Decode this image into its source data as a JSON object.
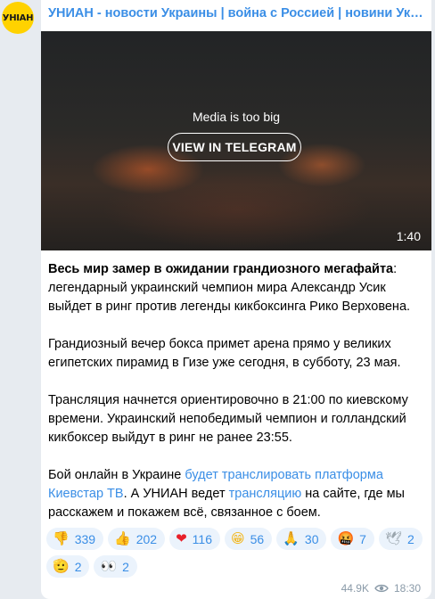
{
  "channel": {
    "avatar_text": "УНІАН",
    "name": "УНИАН - новости Украины | война с Россией | новини Україні…"
  },
  "media": {
    "message": "Media is too big",
    "button_label": "VIEW IN TELEGRAM",
    "duration": "1:40"
  },
  "post": {
    "p1_bold": "Весь мир замер в ожидании грандиозного мегафайта",
    "p1_rest": ": легендарный украинский чемпион мира Александр Усик выйдет в ринг против легенды кикбоксинга Рико Верховена.",
    "p2": "Грандиозный вечер бокса примет арена прямо у великих египетских пирамид в Гизе уже сегодня, в субботу, 23 мая.",
    "p3": "Трансляция начнется ориентировочно в 21:00 по киевскому времени. Украинский непобедимый чемпион и голландский кикбоксер выйдут в ринг не ранее 23:55.",
    "p4_a": "Бой онлайн в Украине ",
    "p4_link1": "будет транслировать платформа Киевстар ТВ",
    "p4_b": ". А УНИАН ведет ",
    "p4_link2": "трансляцию",
    "p4_c": " на сайте, где мы расскажем и покажем всё, связанное с боем."
  },
  "reactions": [
    {
      "emoji": "👎",
      "icon": "thumbs-down-icon",
      "count": "339",
      "color": "#f4a020"
    },
    {
      "emoji": "👍",
      "icon": "thumbs-up-icon",
      "count": "202",
      "color": "#f4b81a"
    },
    {
      "emoji": "❤",
      "icon": "heart-icon",
      "count": "116",
      "color": "#e8202a"
    },
    {
      "emoji": "😁",
      "icon": "grin-icon",
      "count": "56",
      "color": "#f2b518"
    },
    {
      "emoji": "🙏",
      "icon": "pray-icon",
      "count": "30",
      "color": "#f2b518"
    },
    {
      "emoji": "🤬",
      "icon": "angry-face-icon",
      "count": "7",
      "color": "#d4381c"
    },
    {
      "emoji": "🕊",
      "icon": "dove-icon",
      "count": "2",
      "color": "#9aa5ad"
    },
    {
      "emoji": "🫡",
      "icon": "salute-icon",
      "count": "2",
      "color": "#f2b518"
    },
    {
      "emoji": "👀",
      "icon": "eyes-icon",
      "count": "2",
      "color": "#333333"
    }
  ],
  "footer": {
    "views": "44.9K",
    "time": "18:30"
  },
  "colors": {
    "accent": "#3a8ee6",
    "reaction_bg": "#ebf3fc",
    "page_bg": "#e7ebf0",
    "avatar_bg": "#ffd200"
  }
}
